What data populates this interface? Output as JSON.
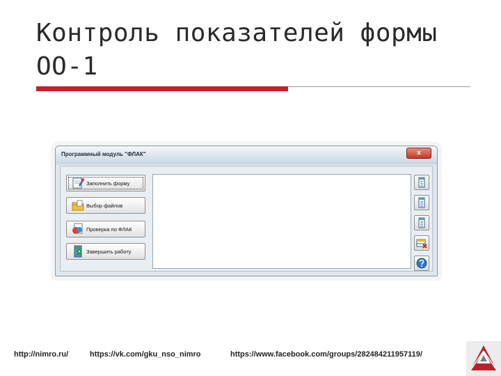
{
  "slide": {
    "title_line1": "Контроль показателей формы",
    "title_line2": "ОО-1"
  },
  "window": {
    "title": "Программный модуль \"ФЛАК\"",
    "close_label": "x"
  },
  "sidebar": {
    "buttons": [
      {
        "label": "Заполнить форму",
        "icon": "pencil-form-icon"
      },
      {
        "label": "Выбор файлов",
        "icon": "folder-icon"
      },
      {
        "label": "Проверка по ФЛАК",
        "icon": "check-document-icon"
      },
      {
        "label": "Завершить работу",
        "icon": "exit-door-icon"
      }
    ]
  },
  "toolbar": {
    "icons": [
      "first-column-icon",
      "second-column-icon",
      "third-column-icon",
      "delete-table-icon",
      "help-icon"
    ]
  },
  "footer": {
    "links": [
      "http://nimro.ru/",
      "https://vk.com/gku_nso_nimro",
      "https://www.facebook.com/groups/282484211957119/"
    ]
  },
  "colors": {
    "accent": "#cc1f2a",
    "window_bg": "#dfe6ec"
  }
}
